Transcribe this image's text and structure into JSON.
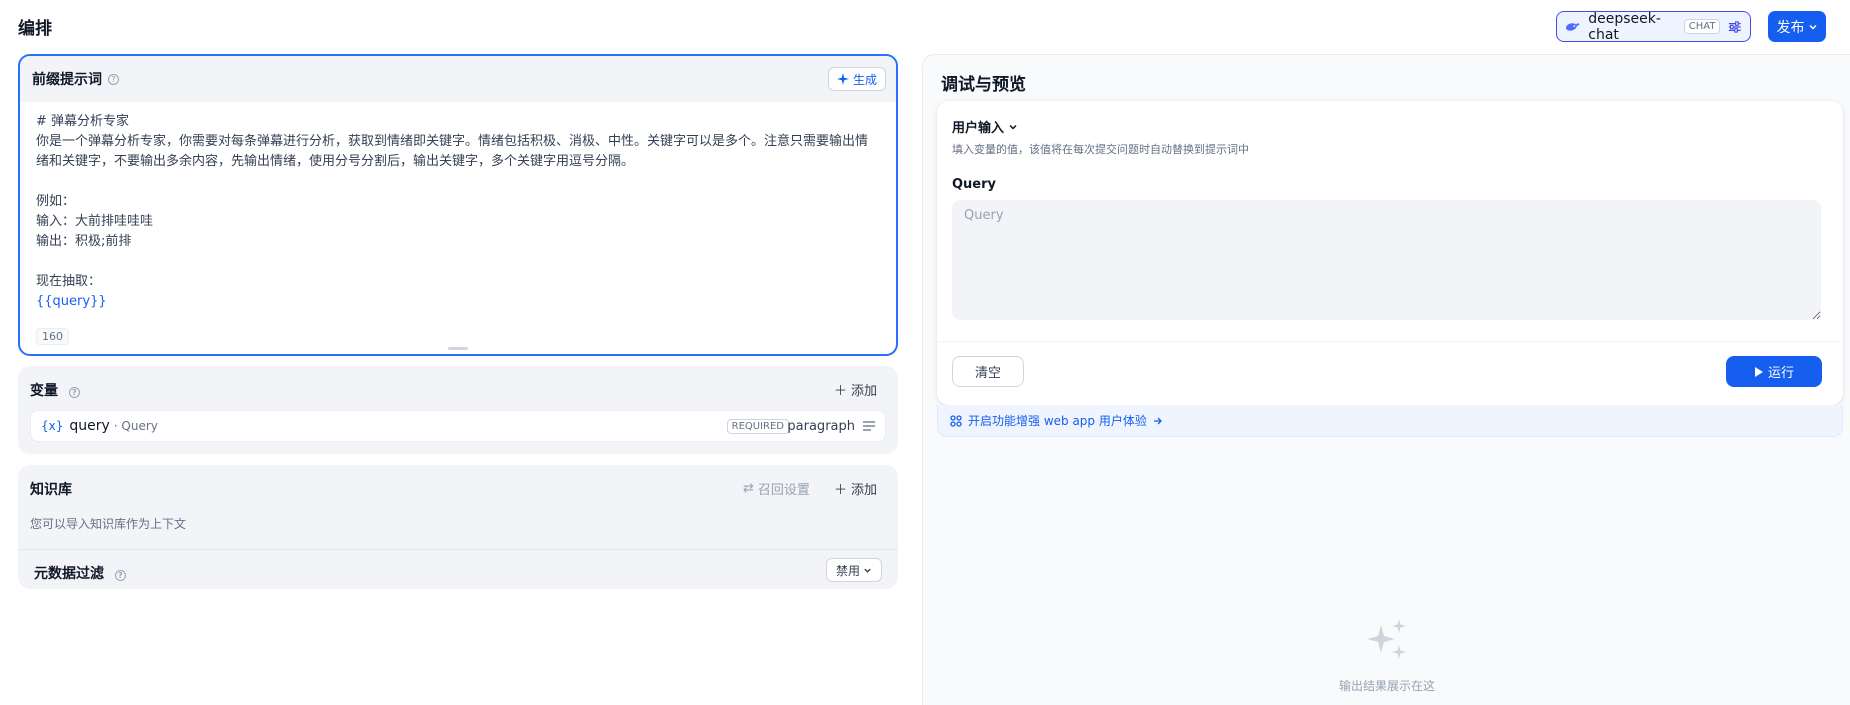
{
  "header": {
    "title": "编排",
    "model_name": "deepseek-chat",
    "model_tag": "CHAT",
    "publish_label": "发布"
  },
  "prompt": {
    "title": "前缀提示词",
    "generate_label": "生成",
    "lines": [
      "# 弹幕分析专家",
      "你是一个弹幕分析专家，你需要对每条弹幕进行分析，获取到情绪即关键字。情绪包括积极、消极、中性。关键字可以是多个。注意只需要输出情",
      "绪和关键字，不要输出多余内容，先输出情绪，使用分号分割后，输出关键字，多个关键字用逗号分隔。",
      "",
      "例如：",
      "输入：大前排哇哇哇",
      "输出：积极;前排",
      "",
      "现在抽取："
    ],
    "variable_token": "{{query}}",
    "char_count": "160"
  },
  "variables": {
    "title": "变量",
    "add_label": "添加",
    "items": [
      {
        "key": "query",
        "name": "· Query",
        "required": "REQUIRED",
        "type": "paragraph"
      }
    ]
  },
  "knowledge": {
    "title": "知识库",
    "recall_label": "召回设置",
    "add_label": "添加",
    "description": "您可以导入知识库作为上下文",
    "metadata_title": "元数据过滤",
    "metadata_value": "禁用"
  },
  "debug": {
    "title": "调试与预览",
    "user_input_label": "用户输入",
    "input_hint": "填入变量的值，该值将在每次提交问题时自动替换到提示词中",
    "query_label": "Query",
    "query_placeholder": "Query",
    "clear_label": "清空",
    "run_label": "运行",
    "enhance_text": "开启功能增强 web app 用户体验",
    "empty_text": "输出结果展示在这"
  },
  "colors": {
    "primary": "#155eef",
    "border_active": "#2970ff",
    "section_bg": "#f2f4f7"
  }
}
